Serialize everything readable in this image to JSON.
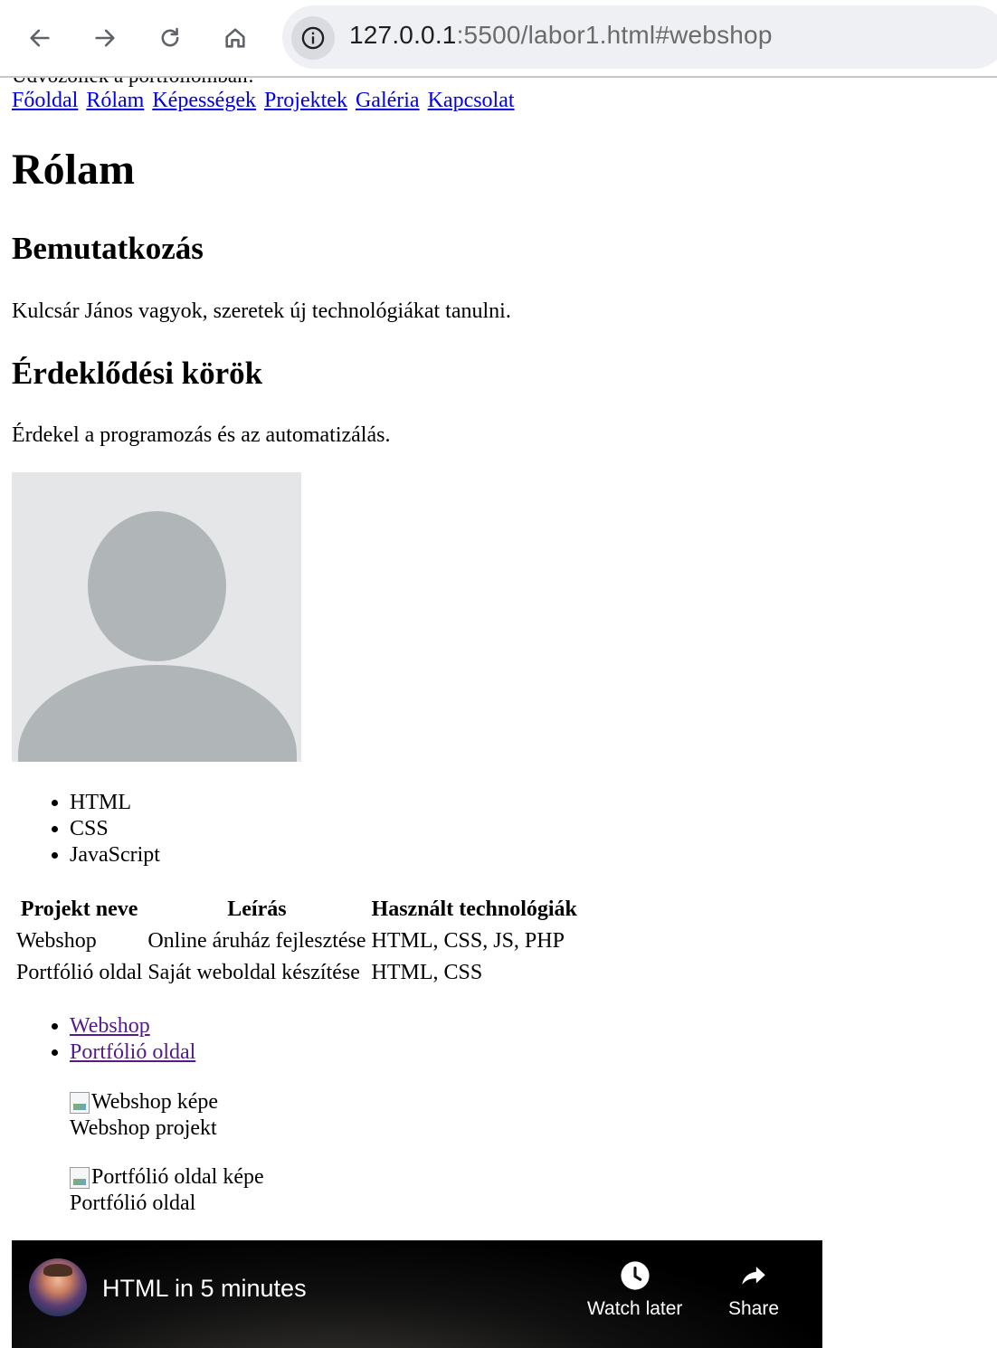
{
  "browser": {
    "url_host": "127.0.0.1",
    "url_rest": ":5500/labor1.html#webshop",
    "icons": [
      "back-arrow-icon",
      "forward-arrow-icon",
      "reload-icon",
      "home-icon",
      "info-icon"
    ]
  },
  "page": {
    "clipped_header": "Üdvözöllek a portfóliómban!",
    "nav": [
      "Főoldal",
      "Rólam",
      "Képességek",
      "Projektek",
      "Galéria",
      "Kapcsolat"
    ],
    "about_title": "Rólam",
    "intro_heading": "Bemutatkozás",
    "intro_text": "Kulcsár János vagyok, szeretek új technológiákat tanulni.",
    "interests_heading": "Érdeklődési körök",
    "interests_text": "Érdekel a programozás és az automatizálás.",
    "skills": [
      "HTML",
      "CSS",
      "JavaScript"
    ],
    "projects_table": {
      "headers": [
        "Projekt neve",
        "Leírás",
        "Használt technológiák"
      ],
      "rows": [
        [
          "Webshop",
          "Online áruház fejlesztése",
          "HTML, CSS, JS, PHP"
        ],
        [
          "Portfólió oldal",
          "Saját weboldal készítése",
          "HTML, CSS"
        ]
      ]
    },
    "project_links": [
      "Webshop",
      "Portfólió oldal"
    ],
    "figures": [
      {
        "alt": "Webshop képe",
        "caption": "Webshop projekt"
      },
      {
        "alt": "Portfólió oldal képe",
        "caption": "Portfólió oldal"
      }
    ]
  },
  "video": {
    "title": "HTML in 5 minutes",
    "watch_later": "Watch later",
    "share": "Share"
  },
  "colors": {
    "link": "#0000ee",
    "visited_link": "#551a8b",
    "avatar_bg": "#e4e6e8",
    "avatar_fg": "#b0b5b7",
    "omnibox_bg": "#eef0f4"
  }
}
